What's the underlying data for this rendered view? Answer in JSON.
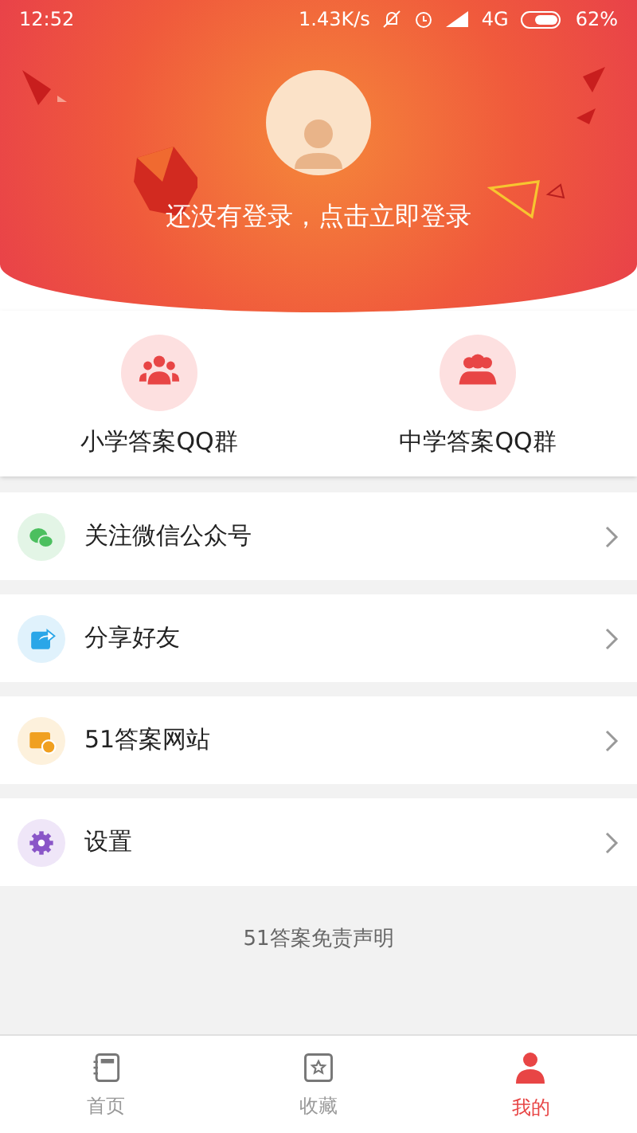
{
  "status_bar": {
    "time": "12:52",
    "speed": "1.43K/s",
    "network": "4G",
    "battery": "62%"
  },
  "login_prompt": "还没有登录，点击立即登录",
  "qq_groups": [
    {
      "label": "小学答案QQ群",
      "kind": "group"
    },
    {
      "label": "中学答案QQ群",
      "kind": "people"
    }
  ],
  "menu": [
    {
      "label": "关注微信公众号",
      "kind": "wechat"
    },
    {
      "label": "分享好友",
      "kind": "share"
    },
    {
      "label": "51答案网站",
      "kind": "web"
    },
    {
      "label": "设置",
      "kind": "settings"
    }
  ],
  "disclaimer": "51答案免责声明",
  "tabs": [
    {
      "label": "首页",
      "kind": "home",
      "selected": false
    },
    {
      "label": "收藏",
      "kind": "star",
      "selected": false
    },
    {
      "label": "我的",
      "kind": "me",
      "selected": true
    }
  ]
}
